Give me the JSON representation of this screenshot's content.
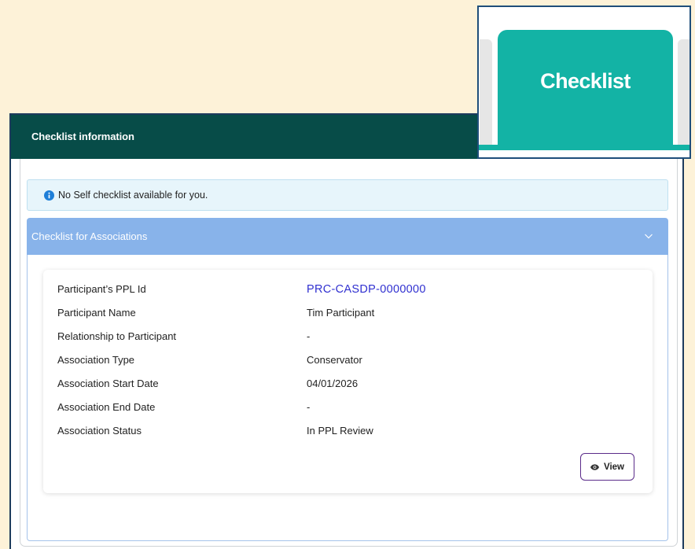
{
  "callout": {
    "tab_label": "Checklist"
  },
  "panel": {
    "title": "Checklist information",
    "alert": {
      "icon": "info-icon",
      "message": "No Self checklist available for you."
    },
    "accordion": {
      "title": "Checklist for Associations",
      "expanded": true,
      "icon": "chevron-down-icon"
    },
    "association": {
      "rows": [
        {
          "label": "Participant’s PPL Id",
          "value": "PRC-CASDP-0000000",
          "is_link": true
        },
        {
          "label": "Participant Name",
          "value": "Tim Participant",
          "is_link": false
        },
        {
          "label": "Relationship to Participant",
          "value": "-",
          "is_link": false
        },
        {
          "label": "Association Type",
          "value": "Conservator",
          "is_link": false
        },
        {
          "label": "Association Start Date",
          "value": "04/01/2026",
          "is_link": false
        },
        {
          "label": "Association End Date",
          "value": "-",
          "is_link": false
        },
        {
          "label": "Association Status",
          "value": "In PPL Review",
          "is_link": false
        }
      ],
      "view_button": {
        "label": "View",
        "icon": "eye-icon"
      }
    }
  },
  "colors": {
    "page_background": "#fdf2d8",
    "header_background": "#074c48",
    "active_tab": "#13b3a5",
    "accordion_header": "#88b3ea",
    "alert_background": "#e7f5fb",
    "link": "#3030d0",
    "view_button_border": "#5b2c8a"
  }
}
